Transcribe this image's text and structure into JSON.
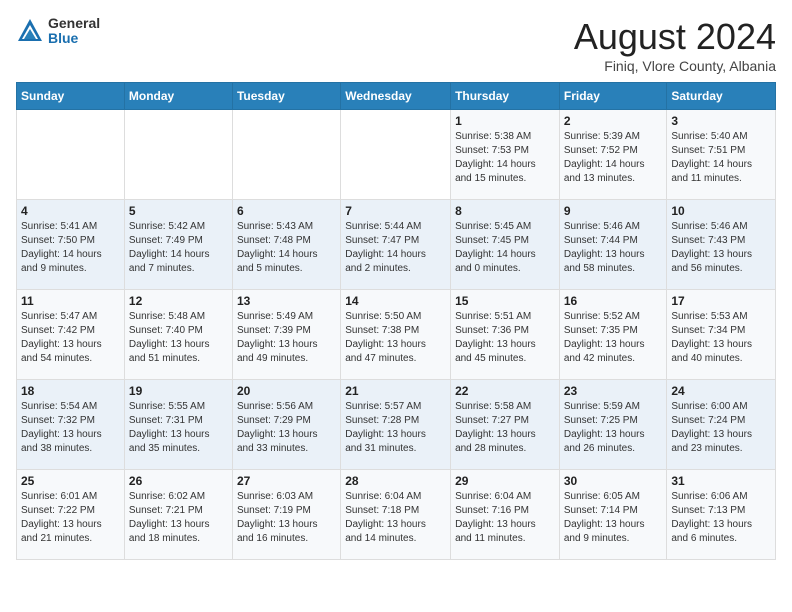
{
  "logo": {
    "general": "General",
    "blue": "Blue"
  },
  "header": {
    "month": "August 2024",
    "location": "Finiq, Vlore County, Albania"
  },
  "weekdays": [
    "Sunday",
    "Monday",
    "Tuesday",
    "Wednesday",
    "Thursday",
    "Friday",
    "Saturday"
  ],
  "weeks": [
    [
      {
        "day": "",
        "info": ""
      },
      {
        "day": "",
        "info": ""
      },
      {
        "day": "",
        "info": ""
      },
      {
        "day": "",
        "info": ""
      },
      {
        "day": "1",
        "info": "Sunrise: 5:38 AM\nSunset: 7:53 PM\nDaylight: 14 hours\nand 15 minutes."
      },
      {
        "day": "2",
        "info": "Sunrise: 5:39 AM\nSunset: 7:52 PM\nDaylight: 14 hours\nand 13 minutes."
      },
      {
        "day": "3",
        "info": "Sunrise: 5:40 AM\nSunset: 7:51 PM\nDaylight: 14 hours\nand 11 minutes."
      }
    ],
    [
      {
        "day": "4",
        "info": "Sunrise: 5:41 AM\nSunset: 7:50 PM\nDaylight: 14 hours\nand 9 minutes."
      },
      {
        "day": "5",
        "info": "Sunrise: 5:42 AM\nSunset: 7:49 PM\nDaylight: 14 hours\nand 7 minutes."
      },
      {
        "day": "6",
        "info": "Sunrise: 5:43 AM\nSunset: 7:48 PM\nDaylight: 14 hours\nand 5 minutes."
      },
      {
        "day": "7",
        "info": "Sunrise: 5:44 AM\nSunset: 7:47 PM\nDaylight: 14 hours\nand 2 minutes."
      },
      {
        "day": "8",
        "info": "Sunrise: 5:45 AM\nSunset: 7:45 PM\nDaylight: 14 hours\nand 0 minutes."
      },
      {
        "day": "9",
        "info": "Sunrise: 5:46 AM\nSunset: 7:44 PM\nDaylight: 13 hours\nand 58 minutes."
      },
      {
        "day": "10",
        "info": "Sunrise: 5:46 AM\nSunset: 7:43 PM\nDaylight: 13 hours\nand 56 minutes."
      }
    ],
    [
      {
        "day": "11",
        "info": "Sunrise: 5:47 AM\nSunset: 7:42 PM\nDaylight: 13 hours\nand 54 minutes."
      },
      {
        "day": "12",
        "info": "Sunrise: 5:48 AM\nSunset: 7:40 PM\nDaylight: 13 hours\nand 51 minutes."
      },
      {
        "day": "13",
        "info": "Sunrise: 5:49 AM\nSunset: 7:39 PM\nDaylight: 13 hours\nand 49 minutes."
      },
      {
        "day": "14",
        "info": "Sunrise: 5:50 AM\nSunset: 7:38 PM\nDaylight: 13 hours\nand 47 minutes."
      },
      {
        "day": "15",
        "info": "Sunrise: 5:51 AM\nSunset: 7:36 PM\nDaylight: 13 hours\nand 45 minutes."
      },
      {
        "day": "16",
        "info": "Sunrise: 5:52 AM\nSunset: 7:35 PM\nDaylight: 13 hours\nand 42 minutes."
      },
      {
        "day": "17",
        "info": "Sunrise: 5:53 AM\nSunset: 7:34 PM\nDaylight: 13 hours\nand 40 minutes."
      }
    ],
    [
      {
        "day": "18",
        "info": "Sunrise: 5:54 AM\nSunset: 7:32 PM\nDaylight: 13 hours\nand 38 minutes."
      },
      {
        "day": "19",
        "info": "Sunrise: 5:55 AM\nSunset: 7:31 PM\nDaylight: 13 hours\nand 35 minutes."
      },
      {
        "day": "20",
        "info": "Sunrise: 5:56 AM\nSunset: 7:29 PM\nDaylight: 13 hours\nand 33 minutes."
      },
      {
        "day": "21",
        "info": "Sunrise: 5:57 AM\nSunset: 7:28 PM\nDaylight: 13 hours\nand 31 minutes."
      },
      {
        "day": "22",
        "info": "Sunrise: 5:58 AM\nSunset: 7:27 PM\nDaylight: 13 hours\nand 28 minutes."
      },
      {
        "day": "23",
        "info": "Sunrise: 5:59 AM\nSunset: 7:25 PM\nDaylight: 13 hours\nand 26 minutes."
      },
      {
        "day": "24",
        "info": "Sunrise: 6:00 AM\nSunset: 7:24 PM\nDaylight: 13 hours\nand 23 minutes."
      }
    ],
    [
      {
        "day": "25",
        "info": "Sunrise: 6:01 AM\nSunset: 7:22 PM\nDaylight: 13 hours\nand 21 minutes."
      },
      {
        "day": "26",
        "info": "Sunrise: 6:02 AM\nSunset: 7:21 PM\nDaylight: 13 hours\nand 18 minutes."
      },
      {
        "day": "27",
        "info": "Sunrise: 6:03 AM\nSunset: 7:19 PM\nDaylight: 13 hours\nand 16 minutes."
      },
      {
        "day": "28",
        "info": "Sunrise: 6:04 AM\nSunset: 7:18 PM\nDaylight: 13 hours\nand 14 minutes."
      },
      {
        "day": "29",
        "info": "Sunrise: 6:04 AM\nSunset: 7:16 PM\nDaylight: 13 hours\nand 11 minutes."
      },
      {
        "day": "30",
        "info": "Sunrise: 6:05 AM\nSunset: 7:14 PM\nDaylight: 13 hours\nand 9 minutes."
      },
      {
        "day": "31",
        "info": "Sunrise: 6:06 AM\nSunset: 7:13 PM\nDaylight: 13 hours\nand 6 minutes."
      }
    ]
  ]
}
